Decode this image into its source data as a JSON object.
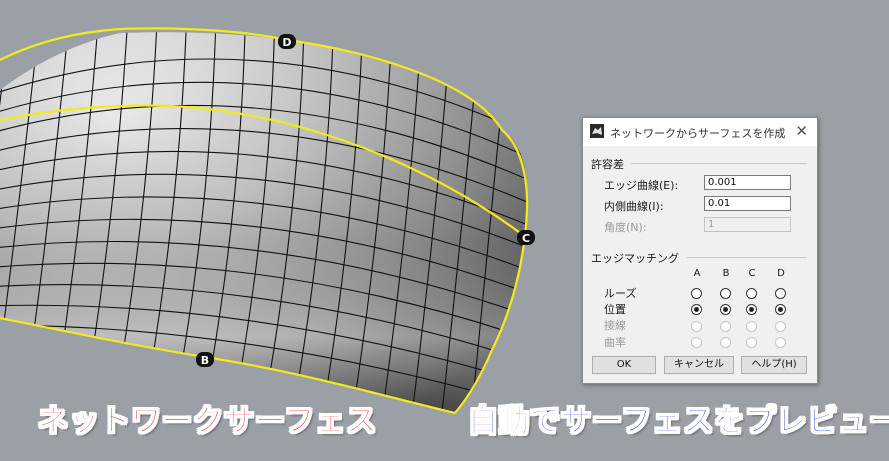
{
  "viewport": {
    "point_labels": [
      "D",
      "C",
      "B"
    ]
  },
  "captions": {
    "left": "ネットワークサーフェス",
    "right": "自動でサーフェスをプレビュー"
  },
  "dialog": {
    "title": "ネットワークからサーフェスを作成",
    "tolerance": {
      "title": "許容差",
      "edge_curves_label": "エッジ曲線(E):",
      "edge_curves_value": "0.001",
      "interior_curves_label": "内側曲線(I):",
      "interior_curves_value": "0.01",
      "angle_label": "角度(N):",
      "angle_value": "1"
    },
    "edge_matching": {
      "title": "エッジマッチング",
      "columns": [
        "A",
        "B",
        "C",
        "D"
      ],
      "rows": [
        {
          "label": "ルーズ",
          "checked": [
            false,
            false,
            false,
            false
          ],
          "disabled": false
        },
        {
          "label": "位置",
          "checked": [
            true,
            true,
            true,
            true
          ],
          "disabled": false
        },
        {
          "label": "接線",
          "checked": [
            false,
            false,
            false,
            false
          ],
          "disabled": true
        },
        {
          "label": "曲率",
          "checked": [
            false,
            false,
            false,
            false
          ],
          "disabled": true
        }
      ]
    },
    "buttons": {
      "ok": "OK",
      "cancel": "キャンセル",
      "help": "ヘルプ(H)"
    }
  },
  "colors": {
    "background": "#9aa0a6",
    "edge_curve": "#f2ea1c",
    "left_caption": "#e8192c",
    "right_caption": "#1d3ed6"
  }
}
